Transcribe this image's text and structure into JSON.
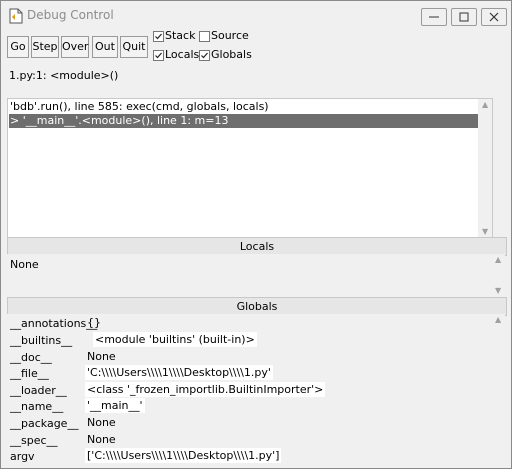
{
  "window": {
    "title": "Debug Control"
  },
  "toolbar": {
    "buttons": [
      "Go",
      "Step",
      "Over",
      "Out",
      "Quit"
    ],
    "options": [
      {
        "label": "Stack",
        "checked": true
      },
      {
        "label": "Source",
        "checked": false
      },
      {
        "label": "Locals",
        "checked": true
      },
      {
        "label": "Globals",
        "checked": true
      }
    ]
  },
  "status_line": "1.py:1: <module>()",
  "stack": [
    {
      "text": "'bdb'.run(), line 585: exec(cmd, globals, locals)",
      "selected": false
    },
    {
      "text": "> '__main__'.<module>(), line 1: m=13",
      "selected": true
    }
  ],
  "locals": {
    "header": "Locals",
    "value": "None"
  },
  "globals": {
    "header": "Globals",
    "rows": [
      {
        "name": "__annotations__",
        "value": "{}"
      },
      {
        "name": "__builtins__",
        "value": "<module 'builtins' (built-in)>"
      },
      {
        "name": "__doc__",
        "value": "None"
      },
      {
        "name": "__file__",
        "value": "'C:\\\\\\\\Users\\\\\\\\1\\\\\\\\Desktop\\\\\\\\1.py'"
      },
      {
        "name": "__loader__",
        "value": "<class '_frozen_importlib.BuiltinImporter'>"
      },
      {
        "name": "__name__",
        "value": "'__main__'"
      },
      {
        "name": "__package__",
        "value": "None"
      },
      {
        "name": "__spec__",
        "value": "None"
      },
      {
        "name": "argv",
        "value": "['C:\\\\\\\\Users\\\\\\\\1\\\\\\\\Desktop\\\\\\\\1.py']"
      }
    ]
  },
  "icons": {
    "app": "idle-file-icon",
    "minimize": "minimize-icon",
    "maximize": "maximize-icon",
    "close": "close-icon"
  }
}
